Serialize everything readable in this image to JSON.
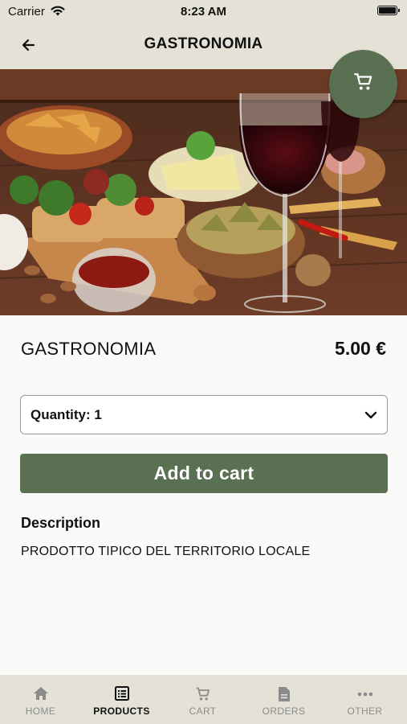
{
  "status_bar": {
    "carrier": "Carrier",
    "time": "8:23 AM"
  },
  "header": {
    "title": "GASTRONOMIA"
  },
  "product": {
    "name": "GASTRONOMIA",
    "price": "5.00 €",
    "quantity_label": "Quantity: 1",
    "add_to_cart_label": "Add to cart",
    "description_heading": "Description",
    "description_text": "PRODOTTO TIPICO DEL TERRITORIO LOCALE"
  },
  "colors": {
    "accent": "#5a7052",
    "bar_background": "#e4e2d6"
  },
  "tabbar": {
    "items": [
      {
        "label": "HOME",
        "icon": "home-icon",
        "active": false
      },
      {
        "label": "PRODUCTS",
        "icon": "list-icon",
        "active": true
      },
      {
        "label": "CART",
        "icon": "cart-icon",
        "active": false
      },
      {
        "label": "ORDERS",
        "icon": "document-icon",
        "active": false
      },
      {
        "label": "OTHER",
        "icon": "more-icon",
        "active": false
      }
    ]
  }
}
